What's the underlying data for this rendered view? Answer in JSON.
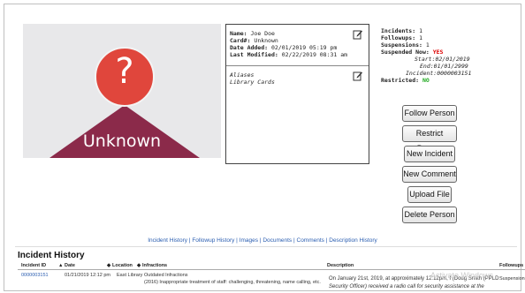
{
  "avatar": {
    "symbol": "?",
    "caption": "Unknown",
    "colors": {
      "head": "#e0463c",
      "body": "#8b2a4a",
      "background": "#e8e8ea"
    }
  },
  "info": {
    "name_label": "Name:",
    "name_value": "Joe Doe",
    "card_label": "Card#:",
    "card_value": "Unknown",
    "added_label": "Date Added:",
    "added_value": "02/01/2019 05:19 pm",
    "modified_label": "Last Modified:",
    "modified_value": "02/22/2019 08:31 am",
    "aliases": "Aliases",
    "library_cards": "Library Cards"
  },
  "stats": {
    "incidents_label": "Incidents:",
    "incidents_value": "1",
    "followups_label": "Followups:",
    "followups_value": "1",
    "suspensions_label": "Suspensions:",
    "suspensions_value": "1",
    "suspended_label": "Suspended Now:",
    "suspended_value": "YES",
    "start_label": "Start:",
    "start_value": "02/01/2019",
    "end_label": "End:",
    "end_value": "01/01/2999",
    "incident_label": "Incident:",
    "incident_value": "0000003151",
    "restricted_label": "Restricted:",
    "restricted_value": "NO"
  },
  "buttons": {
    "follow": "Follow Person",
    "restrict": "Restrict Person",
    "new_incident": "New Incident",
    "new_comment": "New Comment",
    "upload": "Upload File",
    "delete": "Delete Person"
  },
  "tabs": [
    "Incident History",
    "Followup History",
    "Images",
    "Documents",
    "Comments",
    "Description History"
  ],
  "history": {
    "title": "Incident History",
    "columns": [
      "Incident ID",
      "Date",
      "Location",
      "Infractions",
      "Description",
      "Followups"
    ],
    "rows": [
      {
        "id": "0000003151",
        "date": "01/21/2019 12:12 pm",
        "location": "East Library",
        "infraction_1": "Outdated Infractions",
        "infraction_2": "(2016) Inappropriate treatment of staff: challenging, threatening, name calling, etc.",
        "description_1": "On January 21st, 2019, at approximately 12:12pm, I (Doug Smith (PPLD",
        "description_2": "Security Officer) received a radio call for security assistance at the",
        "followups": "Suspension"
      }
    ]
  },
  "watermark": "Activate Windows"
}
